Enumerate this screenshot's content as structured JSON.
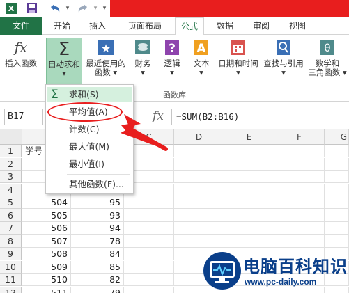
{
  "colors": {
    "excel_green": "#217346",
    "title_red": "#e81e1e",
    "highlight": "#d5f0de",
    "logo_blue": "#0a3f8a"
  },
  "tabs": [
    "文件",
    "开始",
    "插入",
    "页面布局",
    "公式",
    "数据",
    "审阅",
    "视图"
  ],
  "active_tab": "公式",
  "ribbon": {
    "buttons": [
      {
        "line1": "插入函数",
        "line2": "",
        "icon": "fx-icon"
      },
      {
        "line1": "自动求和",
        "line2": "▾",
        "icon": "sigma-icon"
      },
      {
        "line1": "最近使用的",
        "line2": "函数 ▾",
        "icon": "star-icon"
      },
      {
        "line1": "财务",
        "line2": "▾",
        "icon": "coins-icon"
      },
      {
        "line1": "逻辑",
        "line2": "▾",
        "icon": "question-book-icon"
      },
      {
        "line1": "文本",
        "line2": "▾",
        "icon": "text-book-icon"
      },
      {
        "line1": "日期和时间",
        "line2": "▾",
        "icon": "calendar-icon"
      },
      {
        "line1": "查找与引用",
        "line2": "▾",
        "icon": "search-book-icon"
      },
      {
        "line1": "数学和",
        "line2": "三角函数 ▾",
        "icon": "theta-book-icon"
      }
    ],
    "group_label": "函数库"
  },
  "formula_bar": {
    "name_box": "B17",
    "fx": "fx",
    "formula": "=SUM(B2:B16)"
  },
  "dropdown": {
    "items": [
      {
        "label": "求和(S)",
        "icon": "sigma-icon"
      },
      {
        "label": "平均值(A)"
      },
      {
        "label": "计数(C)"
      },
      {
        "label": "最大值(M)"
      },
      {
        "label": "最小值(I)"
      },
      {
        "label": "其他函数(F)..."
      }
    ]
  },
  "grid": {
    "columns": [
      "C",
      "D",
      "E",
      "F",
      "G"
    ],
    "rows": [
      {
        "n": "1",
        "a": "学号",
        "b": ""
      },
      {
        "n": "2",
        "a": "",
        "b": ""
      },
      {
        "n": "3",
        "a": "",
        "b": ""
      },
      {
        "n": "4",
        "a": "",
        "b": ""
      },
      {
        "n": "5",
        "a": "504",
        "b": "95"
      },
      {
        "n": "6",
        "a": "505",
        "b": "93"
      },
      {
        "n": "7",
        "a": "506",
        "b": "94"
      },
      {
        "n": "8",
        "a": "507",
        "b": "78"
      },
      {
        "n": "9",
        "a": "508",
        "b": "84"
      },
      {
        "n": "10",
        "a": "509",
        "b": "85"
      },
      {
        "n": "11",
        "a": "510",
        "b": "82"
      },
      {
        "n": "12",
        "a": "511",
        "b": "79"
      }
    ]
  },
  "watermark": {
    "title": "电脑百科知识",
    "url": "www.pc-daily.com"
  }
}
